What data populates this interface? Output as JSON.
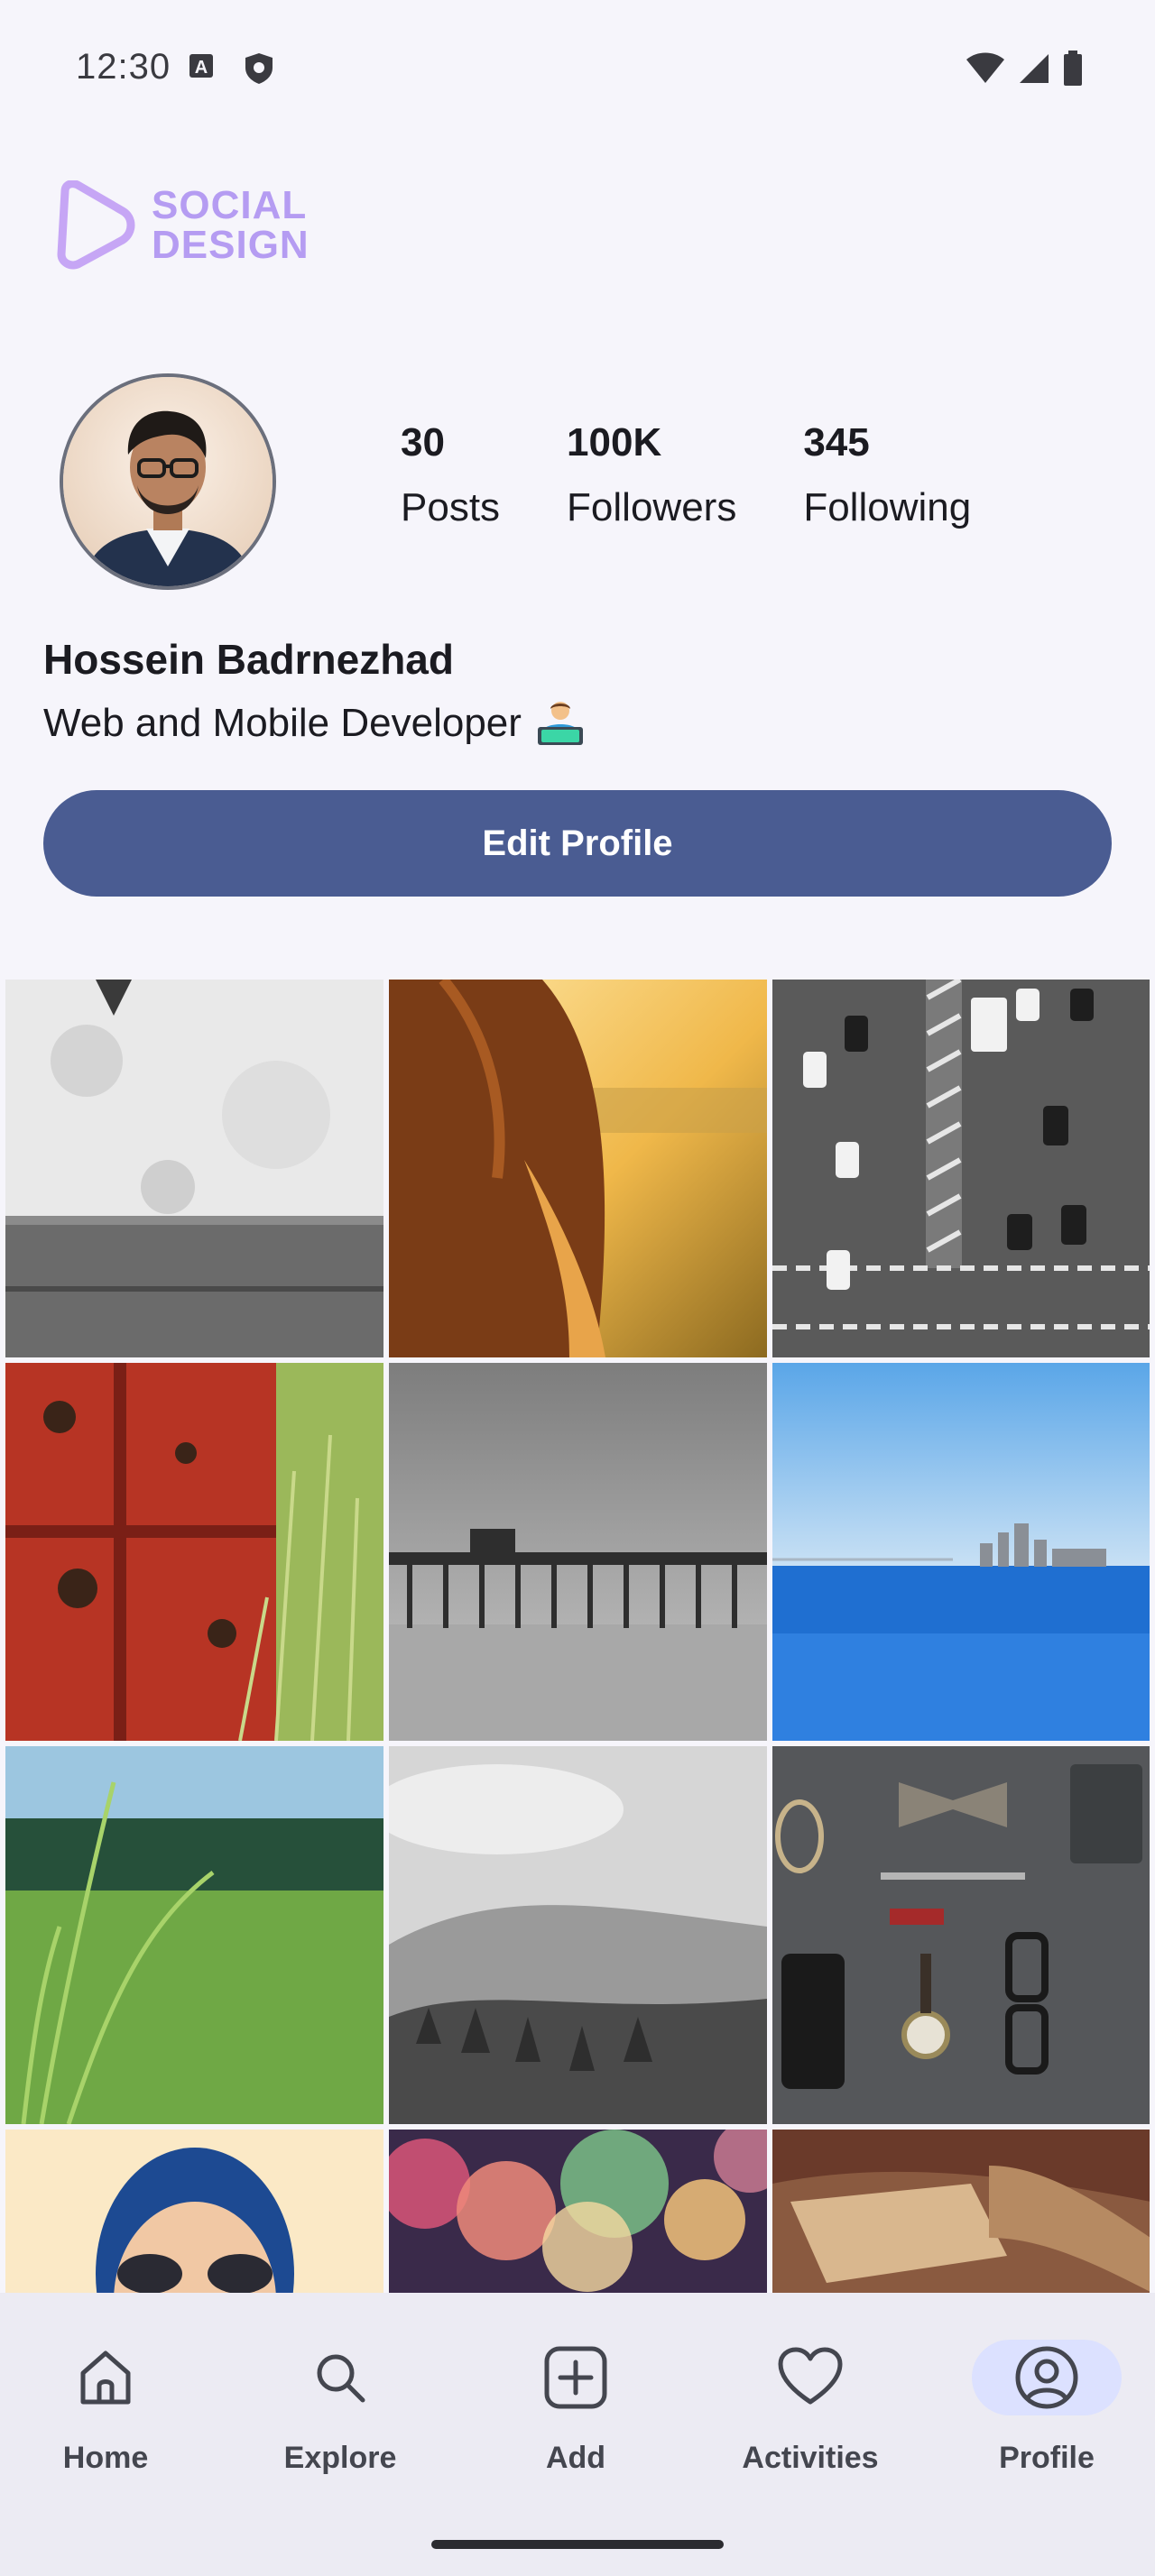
{
  "status_bar": {
    "time": "12:30"
  },
  "brand": {
    "line1": "SOCIAL",
    "line2": "DESIGN",
    "color": "#b59cf2"
  },
  "profile": {
    "name": "Hossein Badrnezhad",
    "bio": "Web and Mobile Developer",
    "stats": [
      {
        "value": "30",
        "label": "Posts"
      },
      {
        "value": "100K",
        "label": "Followers"
      },
      {
        "value": "345",
        "label": "Following"
      }
    ],
    "edit_button": "Edit Profile",
    "accent_color": "#4a5c92"
  },
  "grid": {
    "tiles": [
      "white-wall",
      "sunset-hair",
      "highway-cars",
      "red-barrel-grass",
      "pier-bw",
      "ocean-city",
      "green-grass",
      "hills-bw",
      "flatlay-accessories",
      "woman-sunglasses",
      "bokeh-lights",
      "hand-closeup"
    ]
  },
  "nav": {
    "items": [
      {
        "label": "Home",
        "icon": "home-icon"
      },
      {
        "label": "Explore",
        "icon": "search-icon"
      },
      {
        "label": "Add",
        "icon": "add-icon"
      },
      {
        "label": "Activities",
        "icon": "heart-icon"
      },
      {
        "label": "Profile",
        "icon": "profile-icon",
        "active": true
      }
    ]
  }
}
